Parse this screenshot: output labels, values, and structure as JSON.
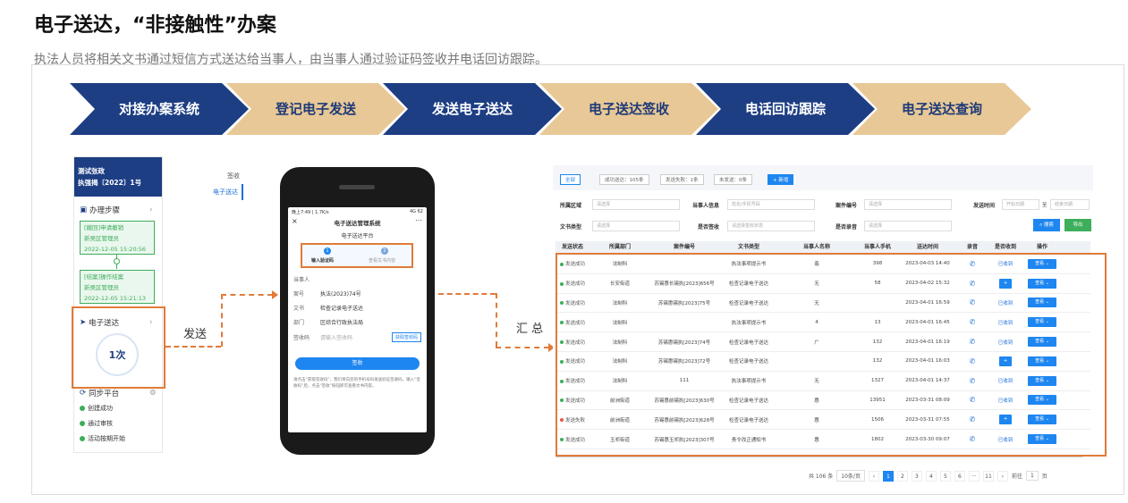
{
  "title": "电子送达，“非接触性”办案",
  "subtitle": "执法人员将相关文书通过短信方式送达给当事人，由当事人通过验证码签收并电话回访跟踪。",
  "steps": [
    {
      "label": "对接办案系统",
      "style": "dark"
    },
    {
      "label": "登记电子发送",
      "style": "light"
    },
    {
      "label": "发送电子送达",
      "style": "dark"
    },
    {
      "label": "电子送达签收",
      "style": "light"
    },
    {
      "label": "电话回访跟踪",
      "style": "dark"
    },
    {
      "label": "电子送达查询",
      "style": "light"
    }
  ],
  "colors": {
    "navy": "#1d3e83",
    "tan": "#e8c896",
    "orange": "#e07b39",
    "blue": "#1e86f0",
    "green": "#3dae5b"
  },
  "left_panel": {
    "header_line1": "测试张政",
    "header_line2": "执强揭〔2022〕1号",
    "section1": "办理步骤",
    "box1": [
      "[撤回]申请撤销",
      "新吴区管理员",
      "2022-12-05 15:20:56"
    ],
    "box2": [
      "[结案]操作结案",
      "新吴区管理员",
      "2022-12-05 15:21:13"
    ],
    "section2": "电子送达",
    "count": "1次",
    "section3": "同步平台",
    "notes": [
      "创建成功",
      "通过审核",
      "活动按期开始"
    ]
  },
  "labels": {
    "send": "发送",
    "summary": "汇 总"
  },
  "tabs": [
    "签收",
    "电子送达"
  ],
  "phone": {
    "status": "晚上7:49 | 1.7K/s",
    "signal": "4G 62",
    "app_title": "电子送达管理系统",
    "platform": "电子送达平台",
    "step1": "输入验证码",
    "step2": "查看文书内容",
    "fields": [
      {
        "label": "当事人",
        "value": ""
      },
      {
        "label": "案号",
        "value": "执法(2023)74号"
      },
      {
        "label": "文书",
        "value": "检查记录电子送达"
      },
      {
        "label": "部门",
        "value": "区综合行政执法局"
      }
    ],
    "sign_label": "签收码",
    "sign_placeholder": "请输入签收码",
    "get_code": "获取签收码",
    "submit": "签收",
    "tip": "请点击“获取签收码”，我们将向您的手机号码发送验证签收码，输入“签收码”后，点击“签收”按钮即可查看文书内容。"
  },
  "table": {
    "pills": [
      "全部",
      "成功送达：105条",
      "发送失败：1条",
      "未发送：0条",
      "+ 新增"
    ],
    "filters": {
      "area_label": "所属区域",
      "area_ph": "请选择",
      "person_label": "当事人信息",
      "person_ph": "姓名/手机号码",
      "case_label": "案件编号",
      "case_ph": "请选择",
      "time_label": "发送时间",
      "time_start": "开始日期",
      "time_to": "至",
      "time_end": "结束日期",
      "doctype_label": "文书类型",
      "doctype_ph": "请选择",
      "signed_label": "是否签收",
      "signed_ph": "请选择签收状态",
      "record_label": "是否录音",
      "record_ph": "请选择",
      "search": "搜索",
      "export": "导出"
    },
    "headers": [
      "发送状态",
      "所属部门",
      "案件编号",
      "文书类型",
      "当事人名称",
      "当事人手机",
      "送达时间",
      "录音",
      "是否收到",
      "操作"
    ],
    "rows": [
      [
        "发送成功",
        "法制科",
        "",
        "执法事项提示书",
        "翡",
        "398",
        "2023-04-03 14:40",
        "phone",
        "已收到",
        "查看"
      ],
      [
        "发送成功",
        "长安街道",
        "苏锡惠长锡执[2023]656号",
        "检查记录电子送达",
        "无",
        "58",
        "2023-04-02 15:32",
        "phone",
        "+",
        "查看"
      ],
      [
        "发送成功",
        "法制科",
        "苏锡惠锡执[2023]75号",
        "检查记录电子送达",
        "无",
        "",
        "2023-04-01 16:59",
        "phone",
        "已收到",
        "查看"
      ],
      [
        "发送成功",
        "法制科",
        "",
        "执法事项提示书",
        "4",
        "13",
        "2023-04-01 16:45",
        "phone",
        "已收到",
        "查看"
      ],
      [
        "发送成功",
        "法制科",
        "苏锡惠锡执[2023]74号",
        "检查记录电子送达",
        "广",
        "132",
        "2023-04-01 16:19",
        "phone",
        "已收到",
        "查看"
      ],
      [
        "发送成功",
        "法制科",
        "苏锡惠锡执[2023]72号",
        "检查记录电子送达",
        "",
        "132",
        "2023-04-01 16:03",
        "phone",
        "+",
        "查看"
      ],
      [
        "发送成功",
        "法制科",
        "111",
        "执法事项提示书",
        "无",
        "1327",
        "2023-04-01 14:37",
        "phone",
        "已收到",
        "查看"
      ],
      [
        "发送成功",
        "前洲街道",
        "苏锡惠前锡执[2023]630号",
        "检查记录电子送达",
        "惠",
        "13951",
        "2023-03-31 08:09",
        "phone",
        "已收到",
        "查看"
      ],
      [
        "发送失败",
        "前洲街道",
        "苏锡惠前锡执[2023]628号",
        "检查记录电子送达",
        "惠",
        "1506",
        "2023-03-31 07:55",
        "phone",
        "+",
        "查看"
      ],
      [
        "发送成功",
        "玉祁街道",
        "苏锡惠玉祁执[2023]307号",
        "责令改正通知书",
        "惠",
        "1802",
        "2023-03-30 09:07",
        "phone",
        "已收到",
        "查看"
      ]
    ],
    "pager": {
      "total": "共 106 条",
      "size": "10条/页",
      "pages": [
        "1",
        "2",
        "3",
        "4",
        "5",
        "6",
        "···",
        "11"
      ],
      "goto": "前往",
      "goto_val": "1",
      "page_unit": "页"
    }
  }
}
